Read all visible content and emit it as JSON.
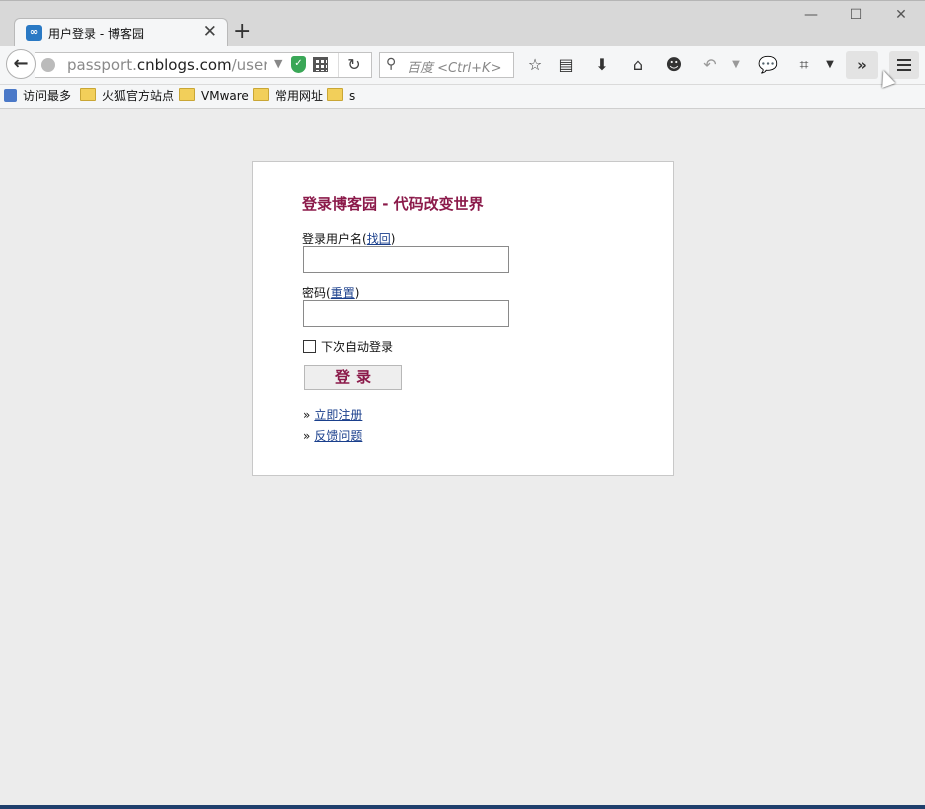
{
  "browser": {
    "tab_title": "用户登录 - 博客园",
    "tab_favicon": "∞",
    "new_tab": "+",
    "window_minimize": "—",
    "window_maximize": "☐",
    "window_close": "✕",
    "url_prefix": "passport.",
    "url_domain": "cnblogs.com",
    "url_path": "/user/sig",
    "search_placeholder": "百度 <Ctrl+K>",
    "overflow": "»"
  },
  "bookmarks": [
    {
      "label": "访问最多",
      "icon": "bookmark-star-icon"
    },
    {
      "label": "火狐官方站点",
      "icon": "folder-icon"
    },
    {
      "label": "VMware",
      "icon": "folder-icon"
    },
    {
      "label": "常用网址",
      "icon": "folder-icon"
    },
    {
      "label": "s",
      "icon": "folder-icon"
    }
  ],
  "login": {
    "title": "登录博客园 - 代码改变世界",
    "username_label": "登录用户名",
    "username_paren_open": "(",
    "username_link": "找回",
    "username_paren_close": ")",
    "username_value": "",
    "password_label": "密码",
    "password_paren_open": "(",
    "password_link": "重置",
    "password_paren_close": ")",
    "password_value": "",
    "remember_label": "下次自动登录",
    "remember_checked": false,
    "submit_label": "登录",
    "link_prefix": "»",
    "register_link": "立即注册",
    "feedback_link": "反馈问题"
  }
}
